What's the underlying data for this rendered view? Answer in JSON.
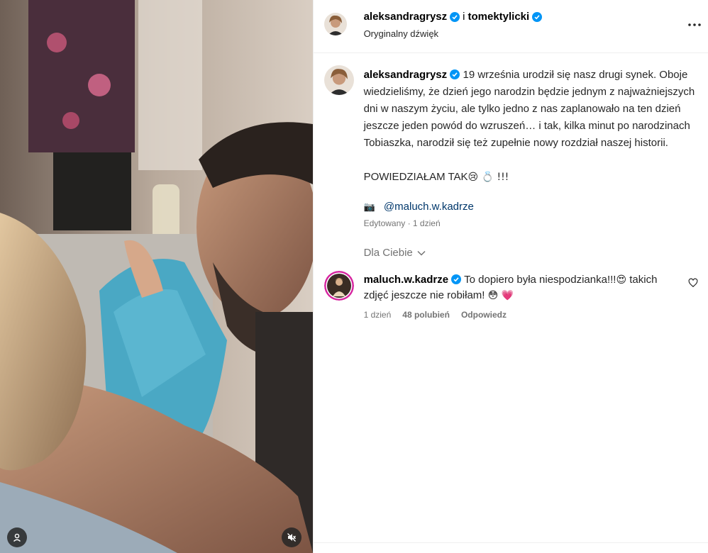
{
  "header": {
    "user1": "aleksandragrysz",
    "separator": "i",
    "user2": "tomektylicki",
    "audio": "Oryginalny dźwięk"
  },
  "caption": {
    "username": "aleksandragrysz",
    "text": "19 września urodził się nasz drugi synek. Oboje wiedzieliśmy, że dzień jego narodzin będzie jednym z najważniejszych dni w naszym życiu, ale tylko jedno z nas zaplanowało na ten dzień jeszcze jeden powód do wzruszeń… i tak, kilka minut po narodzinach Tobiaszka, narodził się też zupełnie nowy rozdział naszej historii.",
    "para2": "POWIEDZIAŁAM TAK",
    "para2_emoji": "😢 💍 !!!",
    "credit_icon": "📷",
    "credit_link": "@maluch.w.kadrze",
    "edited": "Edytowany · 1 dzień"
  },
  "for_you": "Dla Ciebie",
  "comment": {
    "username": "maluch.w.kadrze",
    "text": "To dopiero była niespodzianka!!!",
    "text_emoji": "😍",
    "text2": "takich zdjęć jeszcze nie robiłam!",
    "text2_emoji": "😳 💗",
    "time": "1 dzień",
    "likes": "48 polubień",
    "reply": "Odpowiedz"
  },
  "colors": {
    "verified": "#0095f6",
    "link": "#00376b",
    "muted": "#737373"
  },
  "icons": {
    "more": "more-dots-icon",
    "chevron": "chevron-down-icon",
    "heart": "heart-outline-icon",
    "user_tag": "user-tag-icon",
    "mute": "speaker-muted-icon"
  }
}
